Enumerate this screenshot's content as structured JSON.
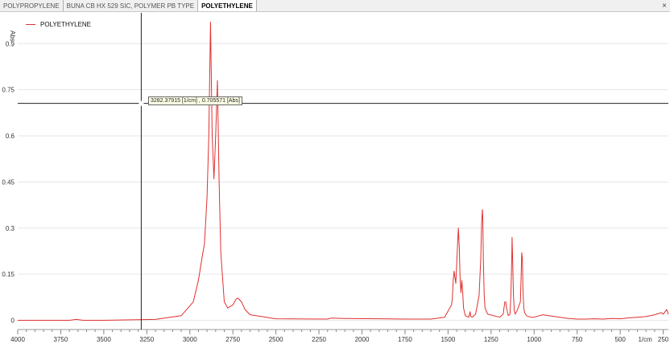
{
  "tabs": [
    {
      "label": "POLYPROPYLENE",
      "active": false
    },
    {
      "label": "BUNA CB HX 529 SIC, POLYMER PB TYPE",
      "active": false
    },
    {
      "label": "POLYETHYLENE",
      "active": true
    }
  ],
  "close_glyph": "×",
  "cursor_readout": "3282.37915 [1/cm] , 0.705571 [Abs]",
  "chart_data": {
    "type": "line",
    "title": "",
    "xlabel": "1/cm",
    "ylabel": "Abs",
    "xlim": [
      4000,
      220
    ],
    "ylim": [
      -0.03,
      1.0
    ],
    "x_reversed": true,
    "x_ticks": [
      4000,
      3750,
      3500,
      3250,
      3000,
      2750,
      2500,
      2250,
      2000,
      1750,
      1500,
      1250,
      1000,
      750,
      500,
      250
    ],
    "y_ticks": [
      0,
      0.15,
      0.3,
      0.45,
      0.6,
      0.75,
      0.9
    ],
    "y_tick_labels": [
      "0",
      "0.15",
      "0.3",
      "0.45",
      "0.6",
      "0.75",
      "0.9"
    ],
    "cursor": {
      "x": 3282.37915,
      "y": 0.705571
    },
    "series": [
      {
        "name": "POLYETHYLENE",
        "color": "#e03030",
        "x": [
          4000,
          3700,
          3660,
          3620,
          3500,
          3200,
          3050,
          2980,
          2950,
          2930,
          2915,
          2900,
          2890,
          2880,
          2870,
          2860,
          2850,
          2840,
          2830,
          2820,
          2800,
          2780,
          2750,
          2730,
          2720,
          2700,
          2680,
          2650,
          2500,
          2200,
          2180,
          2100,
          1900,
          1750,
          1600,
          1520,
          1480,
          1475,
          1470,
          1465,
          1460,
          1455,
          1450,
          1445,
          1440,
          1435,
          1430,
          1425,
          1420,
          1415,
          1410,
          1400,
          1380,
          1372,
          1368,
          1360,
          1340,
          1320,
          1310,
          1305,
          1300,
          1298,
          1295,
          1290,
          1285,
          1270,
          1200,
          1180,
          1170,
          1165,
          1160,
          1150,
          1140,
          1135,
          1130,
          1128,
          1125,
          1120,
          1115,
          1110,
          1100,
          1080,
          1075,
          1072,
          1068,
          1065,
          1060,
          1055,
          1045,
          1020,
          1000,
          950,
          900,
          850,
          800,
          750,
          700,
          650,
          600,
          550,
          500,
          450,
          400,
          350,
          300,
          260,
          250,
          230,
          220
        ],
        "y": [
          0,
          0,
          0.003,
          0,
          0,
          0.003,
          0.015,
          0.06,
          0.13,
          0.2,
          0.25,
          0.4,
          0.6,
          0.97,
          0.6,
          0.46,
          0.6,
          0.78,
          0.45,
          0.22,
          0.06,
          0.04,
          0.05,
          0.07,
          0.072,
          0.06,
          0.035,
          0.018,
          0.005,
          0.004,
          0.007,
          0.006,
          0.005,
          0.004,
          0.004,
          0.01,
          0.05,
          0.07,
          0.13,
          0.16,
          0.14,
          0.12,
          0.18,
          0.24,
          0.3,
          0.24,
          0.13,
          0.09,
          0.13,
          0.09,
          0.04,
          0.015,
          0.01,
          0.028,
          0.012,
          0.01,
          0.02,
          0.08,
          0.2,
          0.32,
          0.36,
          0.32,
          0.2,
          0.08,
          0.04,
          0.02,
          0.01,
          0.02,
          0.06,
          0.06,
          0.04,
          0.015,
          0.02,
          0.08,
          0.2,
          0.27,
          0.2,
          0.08,
          0.03,
          0.02,
          0.03,
          0.06,
          0.15,
          0.22,
          0.2,
          0.1,
          0.04,
          0.025,
          0.015,
          0.01,
          0.01,
          0.018,
          0.014,
          0.01,
          0.006,
          0.004,
          0.004,
          0.005,
          0.004,
          0.006,
          0.005,
          0.008,
          0.01,
          0.012,
          0.018,
          0.025,
          0.02,
          0.035,
          0.02
        ]
      }
    ]
  }
}
